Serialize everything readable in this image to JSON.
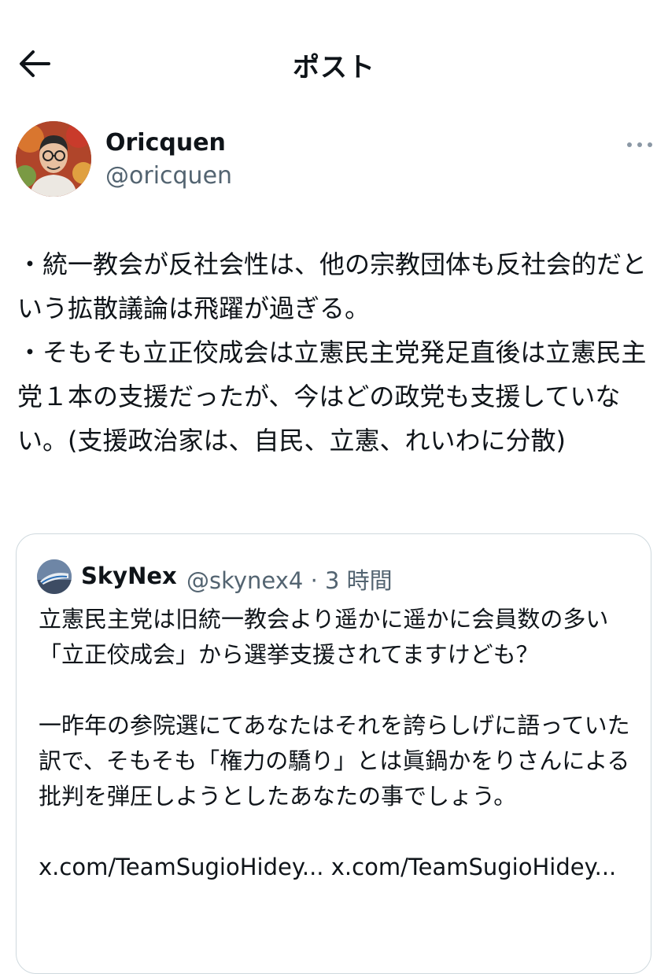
{
  "header": {
    "title": "ポスト",
    "back_icon": "arrow-left-icon"
  },
  "post": {
    "author_name": "Oricquen",
    "author_handle": "@oricquen",
    "more_icon": "more-horizontal-icon",
    "text": "・統一教会が反社会性は、他の宗教団体も反社会的だという拡散議論は飛躍が過ぎる。\n・そもそも立正佼成会は立憲民主党発足直後は立憲民主党１本の支援だったが、今はどの政党も支援していない。(支援政治家は、自民、立憲、れいわに分散)"
  },
  "quote": {
    "author_name": "SkyNex",
    "author_handle": "@skynex4",
    "separator": "·",
    "time": "3 時間",
    "text": "立憲民主党は旧統一教会より遥かに遥かに会員数の多い「立正佼成会」から選挙支援されてますけども？\n\n一昨年の参院選にてあなたはそれを誇らしげに語っていた訳で、そもそも「権力の驕り」とは眞鍋かをりさんによる批判を弾圧しようとしたあなたの事でしょう。\n\nx.com/TeamSugioHidey... x.com/TeamSugioHidey..."
  },
  "colors": {
    "text_primary": "#0f1419",
    "text_secondary": "#536471",
    "border": "#cfd9de"
  }
}
